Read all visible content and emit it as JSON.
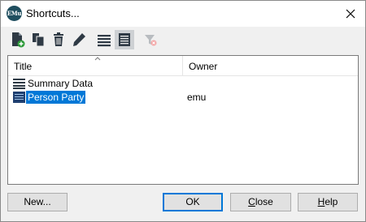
{
  "window": {
    "title": "Shortcuts...",
    "app_icon_text": "EMu"
  },
  "toolbar": {
    "icons": [
      "new-shortcut-icon",
      "copy-icon",
      "delete-icon",
      "edit-icon",
      "list-view-icon",
      "detail-view-icon",
      "clear-filter-icon"
    ]
  },
  "list": {
    "columns": {
      "title": "Title",
      "owner": "Owner"
    },
    "rows": [
      {
        "title": "Summary Data",
        "owner": ""
      },
      {
        "title": "Person Party",
        "owner": "emu"
      }
    ]
  },
  "buttons": {
    "new": "New...",
    "ok": "OK",
    "close_first": "C",
    "close_rest": "lose",
    "help_first": "H",
    "help_rest": "elp"
  },
  "colors": {
    "selection": "#0078d7",
    "app_icon": "#1f4e5f",
    "add_badge": "#2e9b3a"
  }
}
